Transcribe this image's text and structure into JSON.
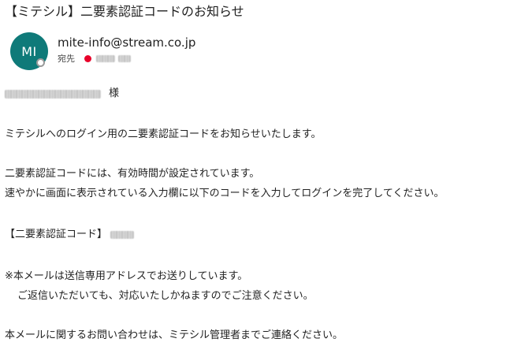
{
  "email": {
    "subject": "【ミテシル】二要素認証コードのお知らせ",
    "sender_initials": "MI",
    "sender_address": "mite-info@stream.co.jp",
    "to_label": "宛先",
    "status_color": "#e8002a",
    "avatar_color": "#0f7a79"
  },
  "body": {
    "salutation_suffix": "様",
    "line_intro": "ミテシルへのログイン用の二要素認証コードをお知らせいたします。",
    "line_validity": "二要素認証コードには、有効時間が設定されています。",
    "line_instruction": "速やかに画面に表示されている入力欄に以下のコードを入力してログインを完了してください。",
    "code_label": "【二要素認証コード】",
    "note_line1": "※本メールは送信専用アドレスでお送りしています。",
    "note_line2": "ご返信いただいても、対応いたしかねますのでご注意ください。",
    "contact_line": "本メールに関するお問い合わせは、ミテシル管理者までご連絡ください。"
  }
}
